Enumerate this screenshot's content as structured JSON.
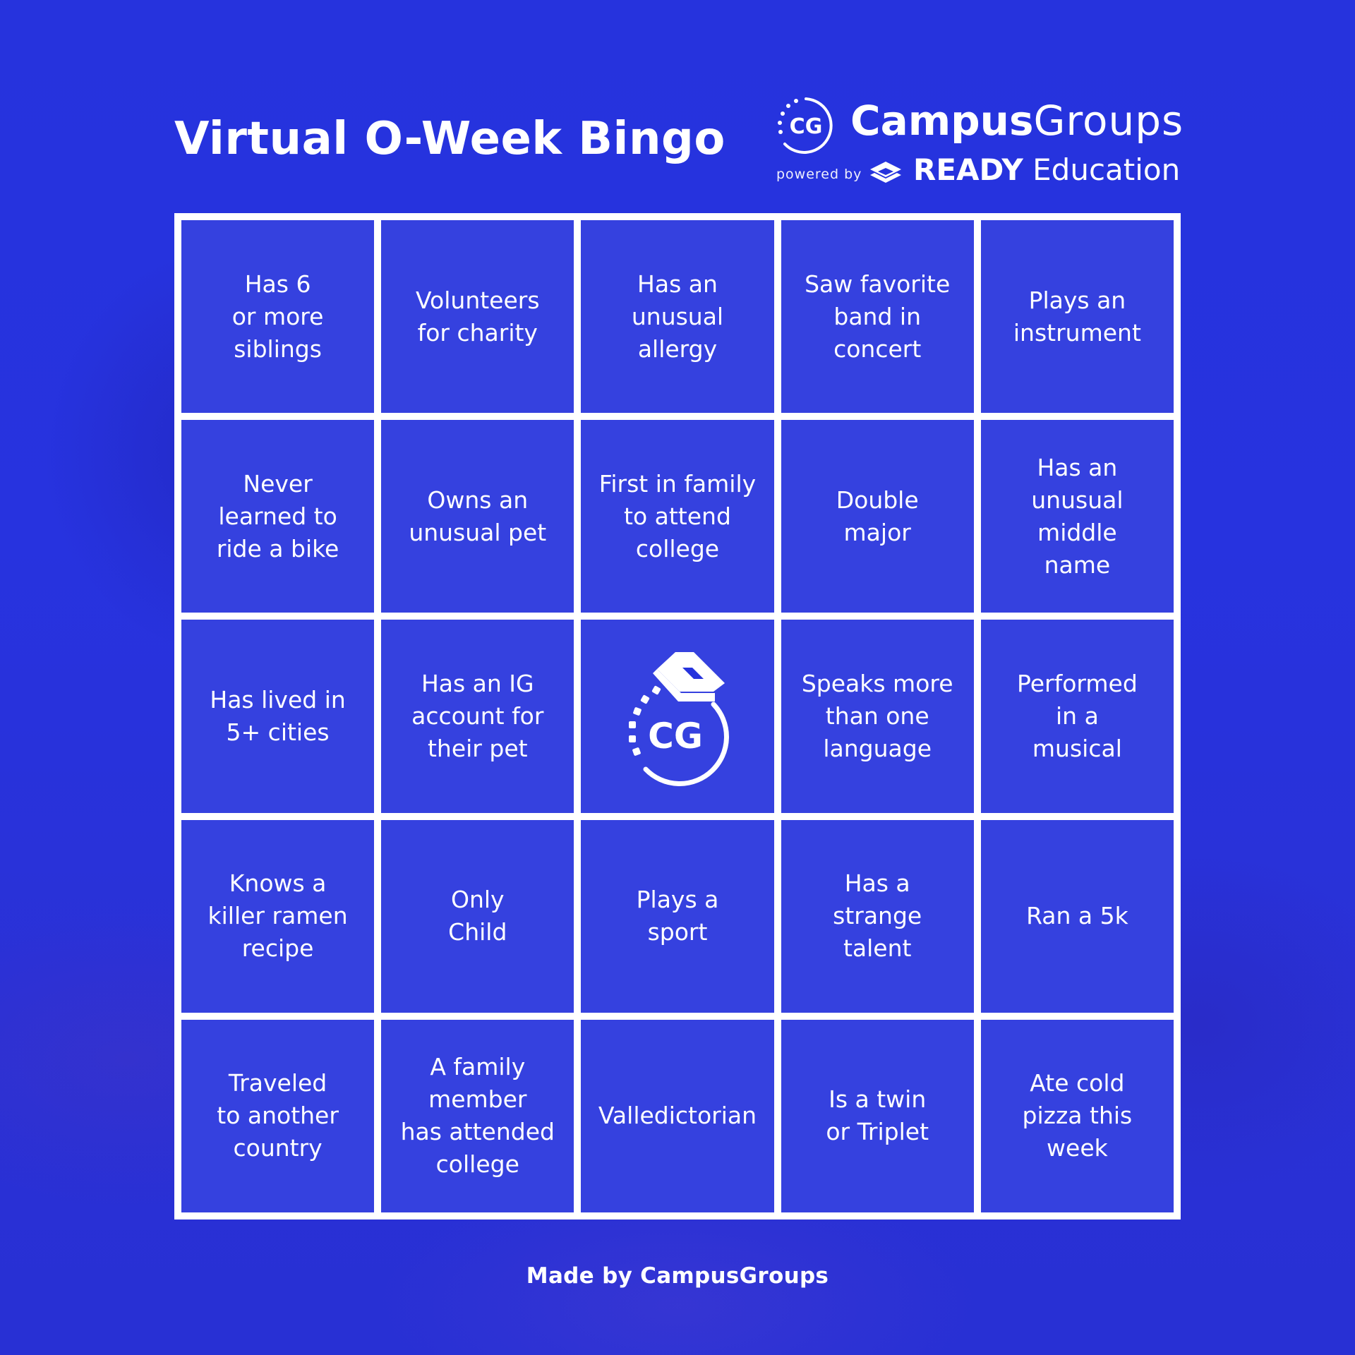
{
  "header": {
    "title": "Virtual O-Week Bingo"
  },
  "brand": {
    "cg_mark_text": "CG",
    "name_bold": "Campus",
    "name_light": "Groups",
    "powered_by": "powered by",
    "partner_bold": "READY",
    "partner_light": "Education"
  },
  "board": {
    "cells": [
      "Has 6\nor more\nsiblings",
      "Volunteers\nfor charity",
      "Has an\nunusual\nallergy",
      "Saw favorite\nband in\nconcert",
      "Plays an\ninstrument",
      "Never\nlearned to\nride a bike",
      "Owns an\nunusual pet",
      "First in family\nto attend\ncollege",
      "Double\nmajor",
      "Has an\nunusual\nmiddle\nname",
      "Has lived in\n5+ cities",
      "Has an IG\naccount for\ntheir pet",
      "",
      "Speaks more\nthan one\nlanguage",
      "Performed\nin a\nmusical",
      "Knows a\nkiller ramen\nrecipe",
      "Only\nChild",
      "Plays a\nsport",
      "Has a\nstrange\ntalent",
      "Ran a 5k",
      "Traveled\nto another\ncountry",
      "A family\nmember\nhas attended\ncollege",
      "Valledictorian",
      "Is a twin\nor Triplet",
      "Ate cold\npizza this\nweek"
    ],
    "free_space": {
      "icon": "campusgroups-graduation-cap-logo",
      "text": "CG"
    }
  },
  "footer": {
    "text": "Made by CampusGroups"
  },
  "colors": {
    "background": "#2633dd",
    "foreground": "#ffffff"
  }
}
